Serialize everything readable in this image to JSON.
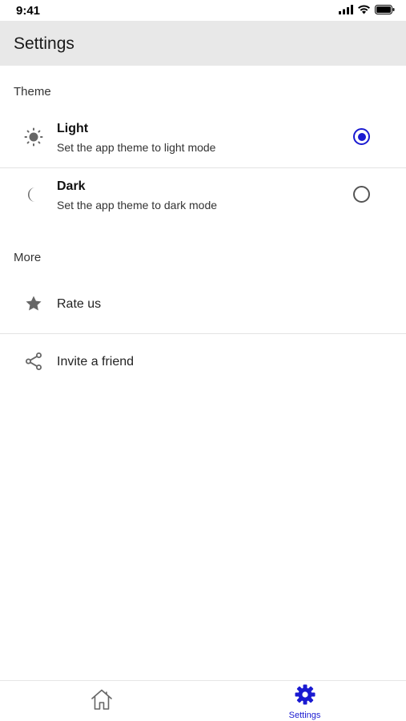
{
  "status_bar": {
    "time": "9:41"
  },
  "header": {
    "title": "Settings"
  },
  "sections": {
    "theme": {
      "label": "Theme",
      "options": [
        {
          "title": "Light",
          "subtitle": "Set the app theme to light mode",
          "icon": "sun-icon",
          "selected": true
        },
        {
          "title": "Dark",
          "subtitle": "Set the app theme to dark mode",
          "icon": "moon-icon",
          "selected": false
        }
      ]
    },
    "more": {
      "label": "More",
      "items": [
        {
          "label": "Rate us",
          "icon": "star-icon"
        },
        {
          "label": "Invite a friend",
          "icon": "share-icon"
        }
      ]
    }
  },
  "bottom_nav": {
    "items": [
      {
        "label": "",
        "icon": "home-icon",
        "active": false
      },
      {
        "label": "Settings",
        "icon": "gear-icon",
        "active": true
      }
    ]
  },
  "colors": {
    "accent": "#1a1ad1",
    "header_bg": "#e8e8e8",
    "icon_gray": "#666666"
  }
}
